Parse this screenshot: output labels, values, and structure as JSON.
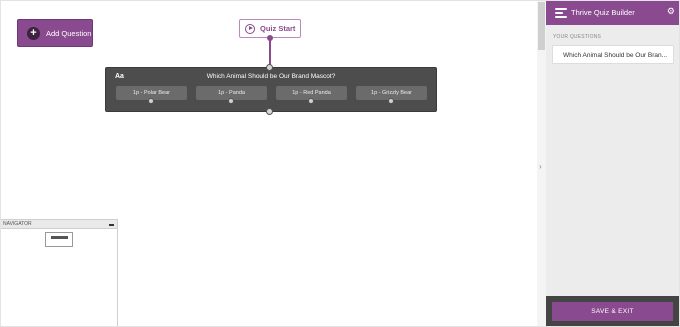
{
  "toolbar": {
    "add_question_label": "Add Question",
    "add_question_icon": "plus-icon"
  },
  "canvas": {
    "start_node": {
      "label": "Quiz Start",
      "icon": "play-icon"
    },
    "question": {
      "type_icon_label": "Aa",
      "title": "Which Animal Should be Our Brand Mascot?",
      "answers": [
        {
          "label": "1p - Polar Bear"
        },
        {
          "label": "1p - Panda"
        },
        {
          "label": "1p - Red Panda"
        },
        {
          "label": "1p - Grizzly Bear"
        }
      ]
    }
  },
  "navigator": {
    "title": "NAVIGATOR",
    "mini_label": "Which Animal Should be Our Brand Mascot?"
  },
  "sidebar": {
    "title": "Thrive Quiz Builder",
    "settings_icon": "gear-icon",
    "section_label": "YOUR QUESTIONS",
    "questions": [
      {
        "label": "Which Animal Should be Our Bran..."
      }
    ],
    "save_exit_label": "SAVE & EXIT"
  },
  "splitter": {
    "toggle_icon": "chevron-right-icon"
  },
  "colors": {
    "accent": "#8a4a8f",
    "card_bg": "#4d4d4d",
    "sidebar_bg": "#ececec",
    "footer_bg": "#444444"
  }
}
